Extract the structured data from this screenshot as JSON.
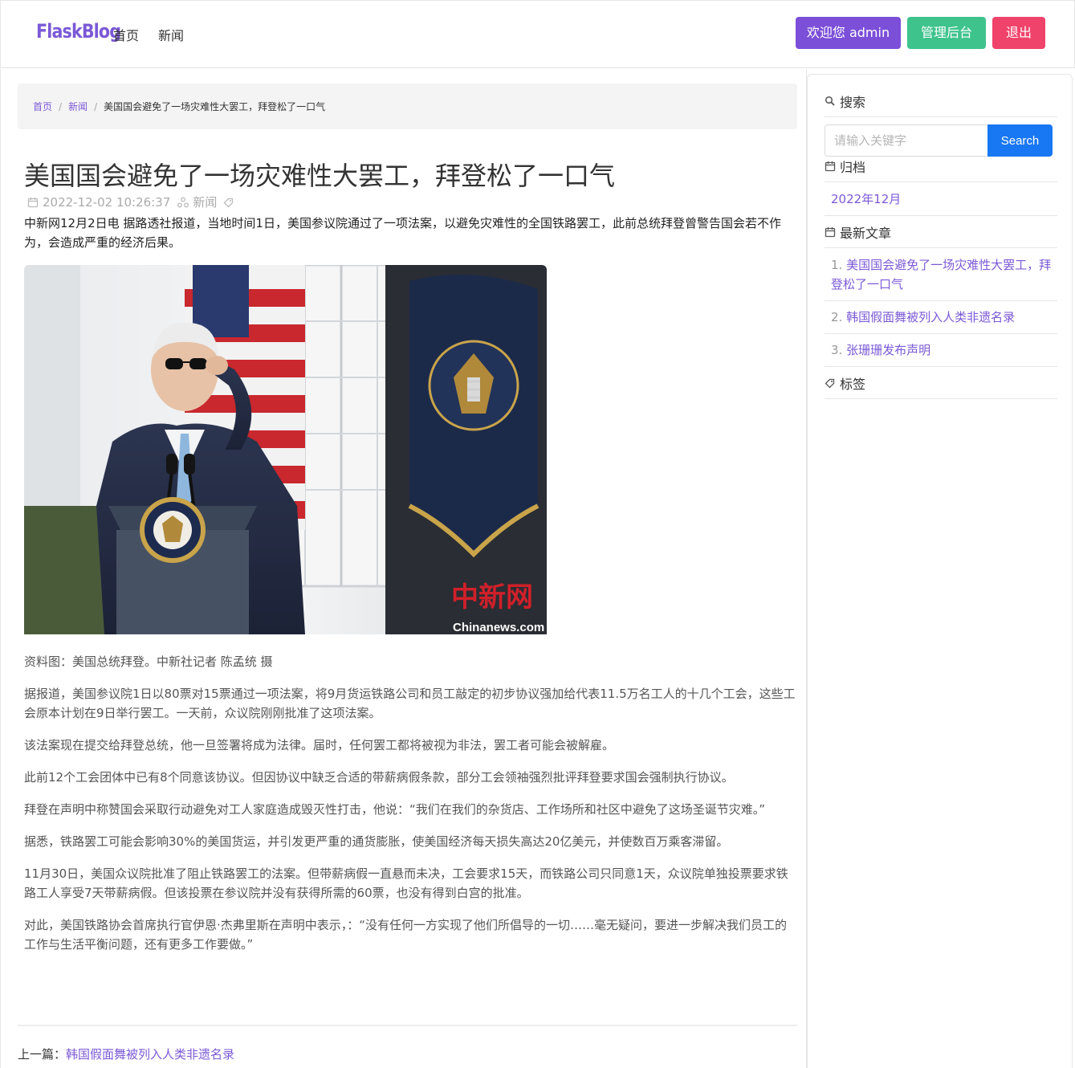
{
  "navbar": {
    "brand": "FlaskBlog",
    "links": [
      "首页",
      "新闻"
    ],
    "welcome": "欢迎您 admin",
    "admin": "管理后台",
    "logout": "退出",
    "colors": {
      "brand": "#7b59d6",
      "welcome": "#7b4fd8",
      "admin": "#3ec38c",
      "logout": "#f0436b"
    }
  },
  "breadcrumb": {
    "home": "首页",
    "category": "新闻",
    "current": "美国国会避免了一场灾难性大罢工，拜登松了一口气"
  },
  "article": {
    "title": "美国国会避免了一场灾难性大罢工，拜登松了一口气",
    "datetime": "2022-12-02 10:26:37",
    "category": "新闻",
    "lead": "中新网12月2日电 据路透社报道，当地时间1日，美国参议院通过了一项法案，以避免灾难性的全国铁路罢工，此前总统拜登曾警告国会若不作为，会造成严重的经济后果。",
    "image_watermark": "中新网",
    "image_watermark_url": "Chinanews.com",
    "paragraphs": [
      "资料图：美国总统拜登。中新社记者 陈孟统 摄",
      "据报道，美国参议院1日以80票对15票通过一项法案，将9月货运铁路公司和员工敲定的初步协议强加给代表11.5万名工人的十几个工会，这些工会原本计划在9日举行罢工。一天前，众议院刚刚批准了这项法案。",
      "该法案现在提交给拜登总统，他一旦签署将成为法律。届时，任何罢工都将被视为非法，罢工者可能会被解雇。",
      "此前12个工会团体中已有8个同意该协议。但因协议中缺乏合适的带薪病假条款，部分工会领袖强烈批评拜登要求国会强制执行协议。",
      "拜登在声明中称赞国会采取行动避免对工人家庭造成毁灭性打击，他说：“我们在我们的杂货店、工作场所和社区中避免了这场圣诞节灾难。”",
      "据悉，铁路罢工可能会影响30%的美国货运，并引发更严重的通货膨胀，使美国经济每天损失高达20亿美元，并使数百万乘客滞留。",
      "11月30日，美国众议院批准了阻止铁路罢工的法案。但带薪病假一直悬而未决，工会要求15天，而铁路公司只同意1天，众议院单独投票要求铁路工人享受7天带薪病假。但该投票在参议院并没有获得所需的60票，也没有得到白宫的批准。",
      "对此，美国铁路协会首席执行官伊恩·杰弗里斯在声明中表示，：“没有任何一方实现了他们所倡导的一切……毫无疑问，要进一步解决我们员工的工作与生活平衡问题，还有更多工作要做。”"
    ],
    "prev_label": "上一篇：",
    "prev_link": "韩国假面舞被列入人类非遗名录"
  },
  "sidebar": {
    "search_title": "搜索",
    "search_placeholder": "请输入关键字",
    "search_button": "Search",
    "archive_title": "归档",
    "archive_items": [
      "2022年12月"
    ],
    "recent_title": "最新文章",
    "recent_items": [
      {
        "num": "1.",
        "text": "美国国会避免了一场灾难性大罢工，拜登松了一口气"
      },
      {
        "num": "2.",
        "text": "韩国假面舞被列入人类非遗名录"
      },
      {
        "num": "3.",
        "text": "张珊珊发布声明"
      }
    ],
    "tags_title": "标签"
  }
}
